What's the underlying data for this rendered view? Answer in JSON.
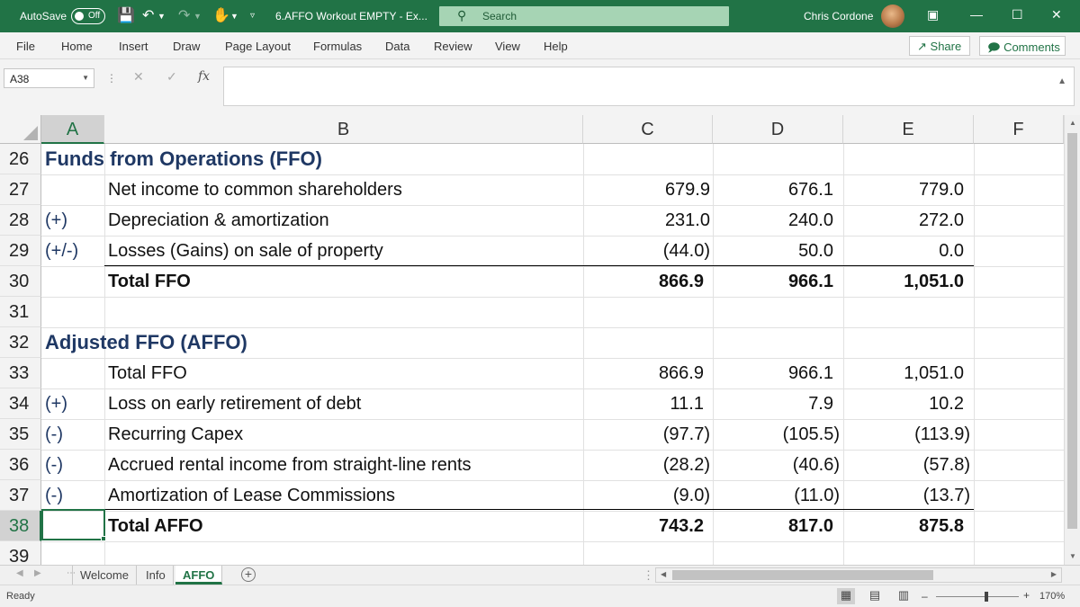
{
  "titlebar": {
    "autosave_label": "AutoSave",
    "autosave_state": "Off",
    "doc_title": "6.AFFO Workout EMPTY  -  Ex...",
    "search_placeholder": "Search",
    "user_name": "Chris Cordone",
    "accent_color": "#217346"
  },
  "ribbon": {
    "tabs": [
      "File",
      "Home",
      "Insert",
      "Draw",
      "Page Layout",
      "Formulas",
      "Data",
      "Review",
      "View",
      "Help"
    ],
    "share_label": "Share",
    "comments_label": "Comments"
  },
  "formula_bar": {
    "name_box": "A38",
    "formula": ""
  },
  "columns": [
    "A",
    "B",
    "C",
    "D",
    "E",
    "F"
  ],
  "selected_column": "A",
  "selected_row": "38",
  "rows": [
    {
      "n": "26",
      "a": "Funds from Operations (FFO)",
      "b": "",
      "c": "",
      "d": "",
      "e": ""
    },
    {
      "n": "27",
      "a": "",
      "b": "Net income to common shareholders",
      "c": "679.9",
      "d": "676.1",
      "e": "779.0"
    },
    {
      "n": "28",
      "a": "(+)",
      "b": "Depreciation & amortization",
      "c": "231.0",
      "d": "240.0",
      "e": "272.0"
    },
    {
      "n": "29",
      "a": "(+/-)",
      "b": "Losses (Gains) on sale of property",
      "c": "(44.0)",
      "d": "50.0",
      "e": "0.0"
    },
    {
      "n": "30",
      "a": "",
      "b": "Total FFO",
      "c": "866.9",
      "d": "966.1",
      "e": "1,051.0"
    },
    {
      "n": "31",
      "a": "",
      "b": "",
      "c": "",
      "d": "",
      "e": ""
    },
    {
      "n": "32",
      "a": "Adjusted FFO (AFFO)",
      "b": "",
      "c": "",
      "d": "",
      "e": ""
    },
    {
      "n": "33",
      "a": "",
      "b": "Total FFO",
      "c": "866.9",
      "d": "966.1",
      "e": "1,051.0"
    },
    {
      "n": "34",
      "a": "(+)",
      "b": "Loss on early retirement of debt",
      "c": "11.1",
      "d": "7.9",
      "e": "10.2"
    },
    {
      "n": "35",
      "a": "(-)",
      "b": "Recurring Capex",
      "c": "(97.7)",
      "d": "(105.5)",
      "e": "(113.9)"
    },
    {
      "n": "36",
      "a": "(-)",
      "b": "Accrued rental income from straight-line rents",
      "c": "(28.2)",
      "d": "(40.6)",
      "e": "(57.8)"
    },
    {
      "n": "37",
      "a": "(-)",
      "b": "Amortization of Lease Commissions",
      "c": "(9.0)",
      "d": "(11.0)",
      "e": "(13.7)"
    },
    {
      "n": "38",
      "a": "",
      "b": "Total AFFO",
      "c": "743.2",
      "d": "817.0",
      "e": "875.8"
    },
    {
      "n": "39",
      "a": "",
      "b": "",
      "c": "",
      "d": "",
      "e": ""
    }
  ],
  "sheets": {
    "tabs": [
      "Welcome",
      "Info",
      "AFFO"
    ],
    "active": "AFFO"
  },
  "statusbar": {
    "status": "Ready",
    "zoom": "170%"
  }
}
